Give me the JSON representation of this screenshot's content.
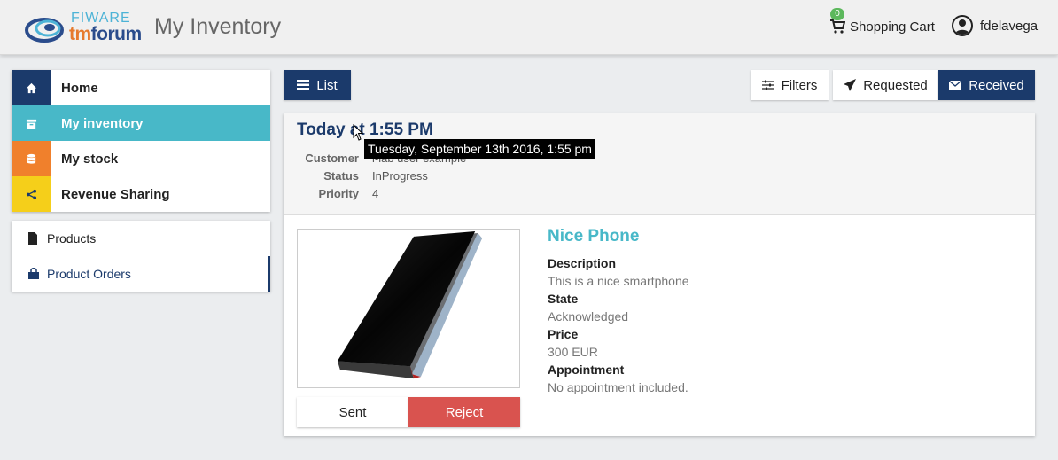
{
  "header": {
    "logo_top": "FIWARE",
    "logo_bottom_a": "tm",
    "logo_bottom_b": "forum",
    "title": "My Inventory",
    "cart_badge": "0",
    "cart_label": "Shopping Cart",
    "username": "fdelavega"
  },
  "sidebar": {
    "items": [
      {
        "label": "Home",
        "icon": "home-icon"
      },
      {
        "label": "My inventory",
        "icon": "archive-icon"
      },
      {
        "label": "My stock",
        "icon": "database-icon"
      },
      {
        "label": "Revenue Sharing",
        "icon": "share-icon"
      }
    ],
    "sub_items": [
      {
        "label": "Products",
        "icon": "file-icon"
      },
      {
        "label": "Product Orders",
        "icon": "shopping-bag-icon"
      }
    ]
  },
  "toolbar": {
    "list_label": "List",
    "filters_label": "Filters",
    "requested_label": "Requested",
    "received_label": "Received"
  },
  "order": {
    "date": "Today at 1:55 PM",
    "tooltip": "Tuesday, September 13th 2016, 1:55 pm",
    "fields": [
      {
        "key": "Customer",
        "value": "i-lab user example"
      },
      {
        "key": "Status",
        "value": "InProgress"
      },
      {
        "key": "Priority",
        "value": "4"
      }
    ]
  },
  "product": {
    "name": "Nice Phone",
    "description_label": "Description",
    "description": "This is a nice smartphone",
    "state_label": "State",
    "state": "Acknowledged",
    "price_label": "Price",
    "price": "300 EUR",
    "appointment_label": "Appointment",
    "appointment": "No appointment included.",
    "sent_label": "Sent",
    "reject_label": "Reject"
  },
  "colors": {
    "navy": "#1b3a6b",
    "teal": "#48b8c8",
    "orange": "#f0802c",
    "yellow": "#f5cf1a",
    "danger": "#d9534f"
  }
}
